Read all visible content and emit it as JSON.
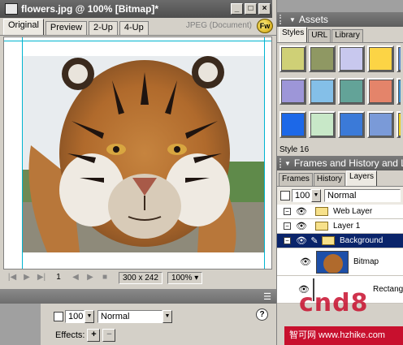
{
  "document": {
    "title": "flowers.jpg @ 100% [Bitmap]*",
    "min_symbol": "_",
    "max_symbol": "□",
    "close_symbol": "×",
    "tabs": [
      "Original",
      "Preview",
      "2-Up",
      "4-Up"
    ],
    "status": "JPEG (Document)",
    "status_icon_text": "Fw"
  },
  "nav": {
    "first": "|◀",
    "play": "▶",
    "last": "▶|",
    "frame": "1",
    "prev": "◀",
    "next": "▶",
    "stop": "■",
    "size": "300 x 242",
    "zoom": "100%",
    "zoom_arrow": "▾"
  },
  "inspector": {
    "menu_icon": "☰",
    "opacity": "100",
    "blend": "Normal",
    "effects_label": "Effects:",
    "add": "+",
    "remove": "−",
    "help": "?"
  },
  "assets": {
    "title": "Assets",
    "tabs": [
      "Styles",
      "URL",
      "Library"
    ],
    "swatches": [
      "#cfd076",
      "#8f9863",
      "#c8c8ee",
      "#fcd445",
      "#5b8ad4",
      "#9d96d8",
      "#84bfe8",
      "#63a398",
      "#e4846a",
      "#3b8fd0",
      "#1c68e8",
      "#c8e8c8",
      "#3b7ad8",
      "#7a9ad8",
      "#f0d020"
    ],
    "style_label": "Style 16"
  },
  "frames": {
    "title": "Frames and History and La",
    "tabs": [
      "Frames",
      "History",
      "Layers"
    ],
    "opacity": "100",
    "blend": "Normal",
    "layers": [
      {
        "name": "Web Layer",
        "selected": false
      },
      {
        "name": "Layer 1",
        "selected": false
      },
      {
        "name": "Background",
        "selected": true
      }
    ],
    "objects": [
      {
        "name": "Bitmap"
      },
      {
        "name": "Rectangle"
      }
    ]
  },
  "watermark": {
    "brand": "cnd8",
    "site": "智可网 www.hzhike.com"
  },
  "colors": {
    "selection": "#0a246a",
    "guide": "#00b4d0",
    "watermark": "#c8102e"
  }
}
